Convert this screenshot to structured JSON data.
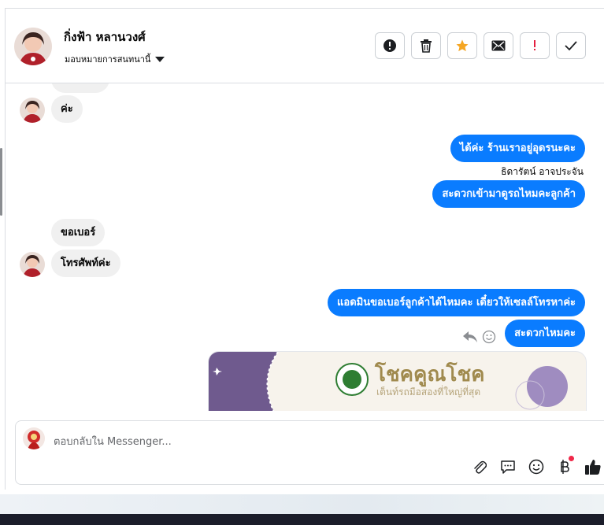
{
  "header": {
    "contact_name": "กิ่งฟ้า หลานวงศ์",
    "assign_label": "มอบหมายการสนทนานี้",
    "actions": [
      {
        "name": "report-button",
        "icon": "exclamation-circle-icon"
      },
      {
        "name": "delete-button",
        "icon": "trash-icon"
      },
      {
        "name": "star-button",
        "icon": "star-icon"
      },
      {
        "name": "mark-unread-button",
        "icon": "envelope-icon"
      },
      {
        "name": "follow-up-button",
        "icon": "exclamation-icon"
      },
      {
        "name": "mark-done-button",
        "icon": "check-icon"
      }
    ]
  },
  "messages": {
    "m1": "ค่ะ",
    "m2": "ได้ค่ะ ร้านเราอยู่อุดรนะคะ",
    "sender_name": "ธิดารัตน์ อาจประจัน",
    "m3": "สะดวกเข้ามาดูรถไหมคะลูกค้า",
    "m4": "ขอเบอร์",
    "m5": "โทรศัพท์ค่ะ",
    "m6": "แอดมินขอเบอร์ลูกค้าได้ไหมคะ เดี๋ยวให้เซลล์โทรหาค่ะ",
    "m7": "สะดวกไหมคะ"
  },
  "card": {
    "logo_title": "โชคคูณโชค",
    "logo_subtitle": "เต็นท์รถมือสองที่ใหญ่ที่สุด"
  },
  "composer": {
    "placeholder": "ตอบกลับใน Messenger..."
  },
  "colors": {
    "outgoing_bubble": "#0a7cff",
    "incoming_bubble": "#f0f0f0",
    "star": "#f5a623",
    "follow_up": "#e41e3f",
    "notification_dot": "#f02849"
  }
}
